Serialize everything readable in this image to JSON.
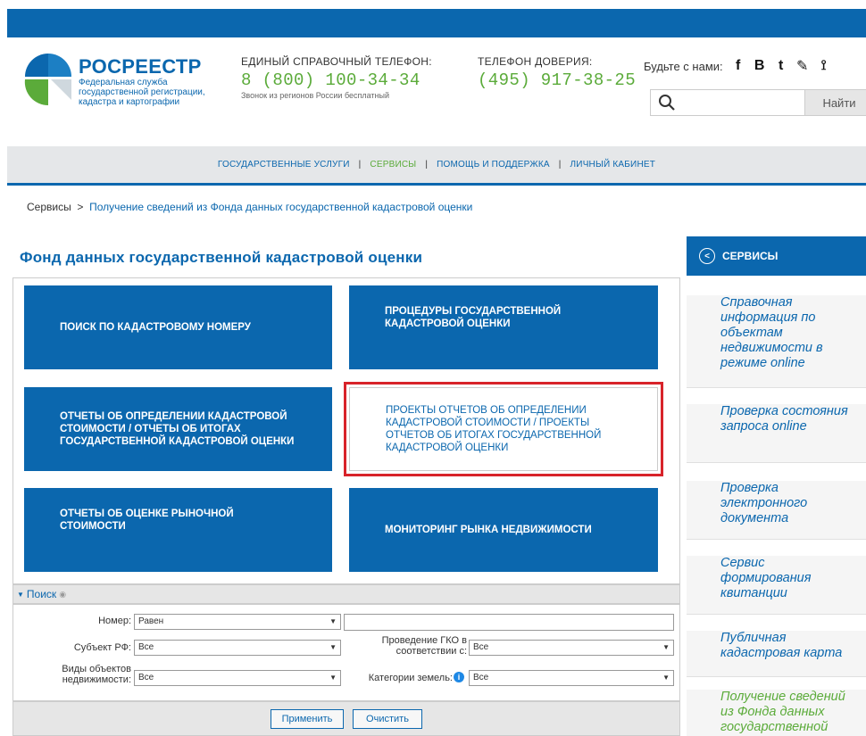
{
  "header": {
    "logo_name": "РОСРЕЕСТР",
    "logo_sub": "Федеральная служба государственной регистрации, кадастра и картографии",
    "phone1_label": "ЕДИНЫЙ СПРАВОЧНЫЙ ТЕЛЕФОН:",
    "phone1_number": "8 (800) 100-34-34",
    "phone1_note": "Звонок из регионов России бесплатный",
    "phone2_label": "ТЕЛЕФОН ДОВЕРИЯ:",
    "phone2_number": "(495) 917-38-25",
    "social_label": "Будьте с нами:",
    "social_icons": [
      "facebook-icon",
      "vk-icon",
      "twitter-icon",
      "livejournal-icon",
      "rss-icon"
    ],
    "social_glyphs": [
      "f",
      "В",
      "t",
      "✎",
      "⟟"
    ],
    "search_placeholder": "",
    "search_button": "Найти"
  },
  "nav": {
    "items": [
      {
        "label": "ГОСУДАРСТВЕННЫЕ УСЛУГИ",
        "active": false
      },
      {
        "label": "СЕРВИСЫ",
        "active": true
      },
      {
        "label": "ПОМОЩЬ И ПОДДЕРЖКА",
        "active": false
      },
      {
        "label": "ЛИЧНЫЙ КАБИНЕТ",
        "active": false
      }
    ],
    "separator": "|"
  },
  "breadcrumb": {
    "root": "Сервисы",
    "separator": ">",
    "current": "Получение сведений из Фонда данных государственной кадастровой оценки"
  },
  "page_title": "Фонд данных государственной кадастровой оценки",
  "tiles": [
    "ПОИСК ПО КАДАСТРОВОМУ НОМЕРУ",
    "ПРОЦЕДУРЫ ГОСУДАРСТВЕННОЙ КАДАСТРОВОЙ ОЦЕНКИ",
    "ОТЧЕТЫ ОБ ОПРЕДЕЛЕНИИ КАДАСТРОВОЙ СТОИМОСТИ / ОТЧЕТЫ ОБ ИТОГАХ ГОСУДАРСТВЕННОЙ КАДАСТРОВОЙ ОЦЕНКИ",
    "ПРОЕКТЫ ОТЧЕТОВ ОБ ОПРЕДЕЛЕНИИ КАДАСТРОВОЙ СТОИМОСТИ / ПРОЕКТЫ ОТЧЕТОВ ОБ ИТОГАХ ГОСУДАРСТВЕННОЙ КАДАСТРОВОЙ ОЦЕНКИ",
    "ОТЧЕТЫ ОБ ОЦЕНКЕ РЫНОЧНОЙ СТОИМОСТИ",
    "МОНИТОРИНГ РЫНКА НЕДВИЖИМОСТИ"
  ],
  "search_panel": {
    "title": "Поиск",
    "number_label": "Номер:",
    "number_op": "Равен",
    "number_value": "",
    "subject_label": "Субъект РФ:",
    "subject_value": "Все",
    "gko_label": "Проведение ГКО в соответствии с:",
    "gko_value": "Все",
    "objects_label": "Виды объектов недвижимости:",
    "objects_value": "Все",
    "land_label": "Категории земель:",
    "land_value": "Все",
    "apply": "Применить",
    "clear": "Очистить"
  },
  "sidebar": {
    "title": "СЕРВИСЫ",
    "items": [
      {
        "label": "Справочная информация по объектам недвижимости в режиме online",
        "active": false
      },
      {
        "label": "Проверка состояния запроса online",
        "active": false
      },
      {
        "label": "Проверка электронного документа",
        "active": false
      },
      {
        "label": "Сервис формирования квитанции",
        "active": false
      },
      {
        "label": "Публичная кадастровая карта",
        "active": false
      },
      {
        "label": "Получение сведений из Фонда данных государственной",
        "active": true
      }
    ]
  },
  "colors": {
    "brand_blue": "#0b67ae",
    "accent_green": "#5bab3a",
    "highlight_red": "#d8232a"
  }
}
